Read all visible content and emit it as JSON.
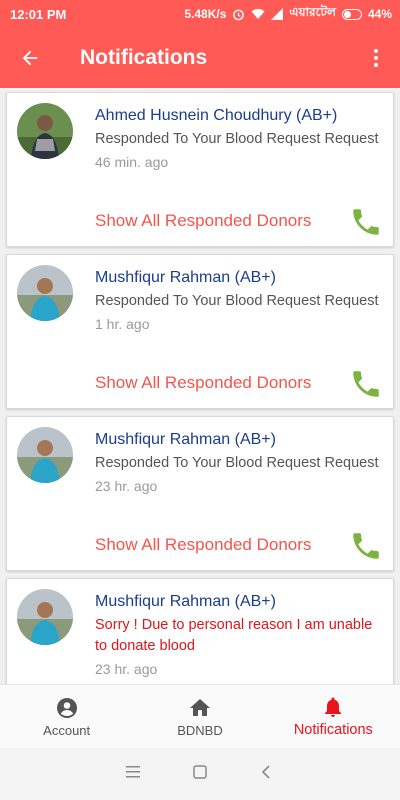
{
  "status_bar": {
    "time": "12:01 PM",
    "speed": "5.48K/s",
    "carrier": "এয়ারটেল",
    "battery": "44%"
  },
  "app_bar": {
    "title": "Notifications",
    "back_icon": "arrow-left-icon",
    "more_icon": "more-vertical-icon"
  },
  "notifications": [
    {
      "name": "Ahmed Husnein Choudhury (AB+)",
      "message": "Responded To Your Blood Request Request",
      "time": "46 min. ago",
      "action": "Show All Responded Donors",
      "show_call": true
    },
    {
      "name": "Mushfiqur Rahman (AB+)",
      "message": "Responded To Your Blood Request Request",
      "time": "1 hr. ago",
      "action": "Show All Responded Donors",
      "show_call": true
    },
    {
      "name": "Mushfiqur Rahman (AB+)",
      "message": "Responded To Your Blood Request Request",
      "time": "23 hr. ago",
      "action": "Show All Responded Donors",
      "show_call": true
    },
    {
      "name": "Mushfiqur Rahman (AB+)",
      "message": "Sorry ! Due to personal reason I am unable to donate blood",
      "time": "23 hr. ago",
      "action": "",
      "show_call": false
    }
  ],
  "bottom_nav": {
    "items": [
      {
        "label": "Account",
        "icon": "account-circle-icon"
      },
      {
        "label": "BDNBD",
        "icon": "home-icon"
      },
      {
        "label": "Notifications",
        "icon": "bell-icon"
      }
    ]
  },
  "colors": {
    "primary": "#ff5a55",
    "name_blue": "#1a3d8f",
    "action_red": "#f5544b",
    "alert_red": "#e0141c",
    "call_green": "#7cb342"
  }
}
